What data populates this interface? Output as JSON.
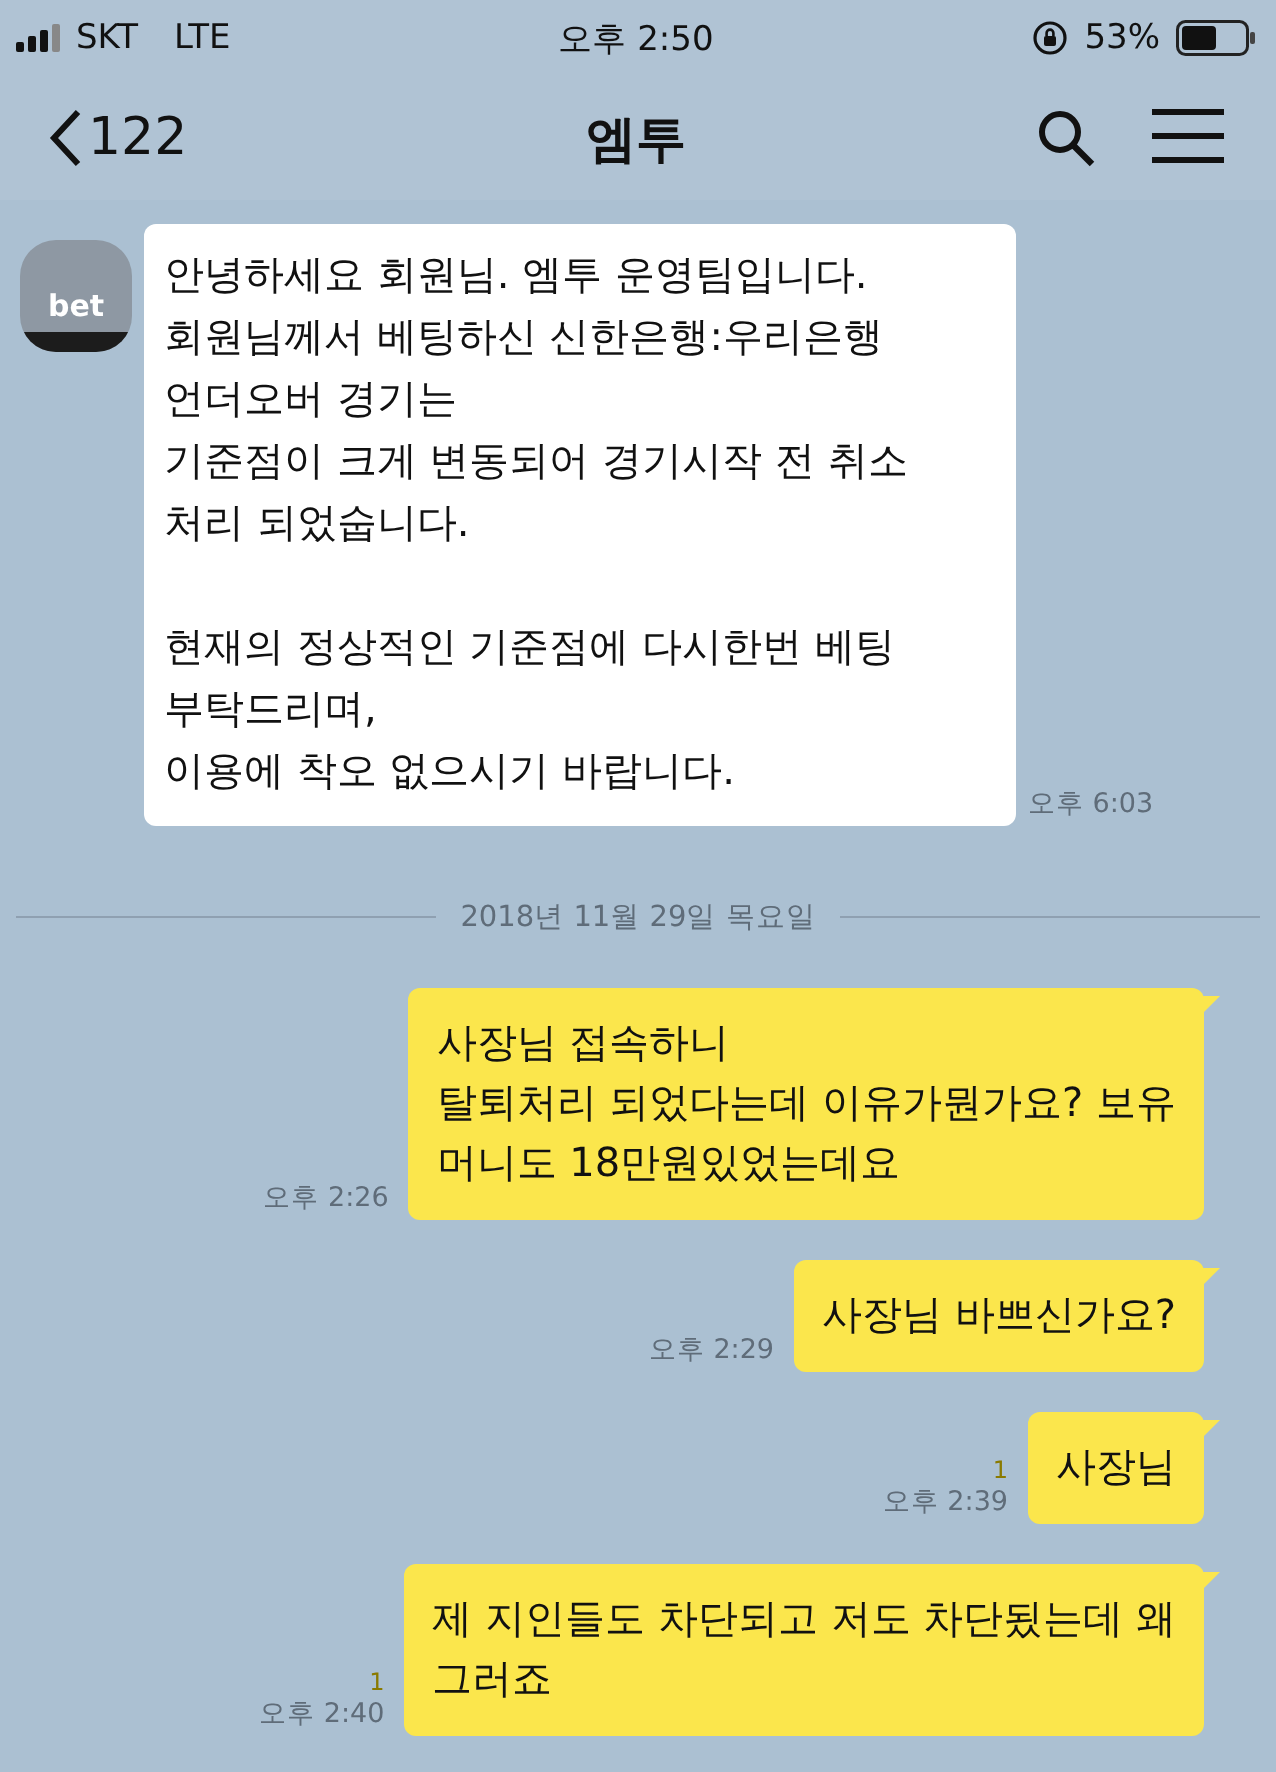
{
  "status_bar": {
    "carrier": "SKT",
    "network": "LTE",
    "time": "오후 2:50",
    "battery": "53%"
  },
  "header": {
    "back_count": "122",
    "title": "엠투"
  },
  "messages": [
    {
      "kind": "incoming",
      "text": "안녕하세요 회원님. 엠투 운영팀입니다.\n회원님께서 베팅하신 신한은행:우리은행\n언더오버 경기는\n기준점이 크게 변동되어 경기시작 전 취소\n처리 되었숩니다.\n\n현재의 정상적인 기준점에 다시한번 베팅\n부탁드리며,\n이용에 착오 없으시기 바랍니다.",
      "time": "오후 6:03",
      "avatar": "bet"
    },
    {
      "kind": "date",
      "text": "2018년 11월 29일 목요일"
    },
    {
      "kind": "outgoing",
      "text": "사장님 접속하니\n탈퇴처리 되었다는데 이유가뭔가요? 보유\n머니도 18만원있었는데요",
      "time": "오후 2:26"
    },
    {
      "kind": "outgoing",
      "text": "사장님 바쁘신가요?",
      "time": "오후 2:29"
    },
    {
      "kind": "outgoing",
      "text": "사장님",
      "time": "오후 2:39",
      "unread": "1"
    },
    {
      "kind": "outgoing",
      "text": "제 지인들도 차단되고 저도 차단됬는데 왜\n그러죠",
      "time": "오후 2:40",
      "unread": "1"
    }
  ]
}
